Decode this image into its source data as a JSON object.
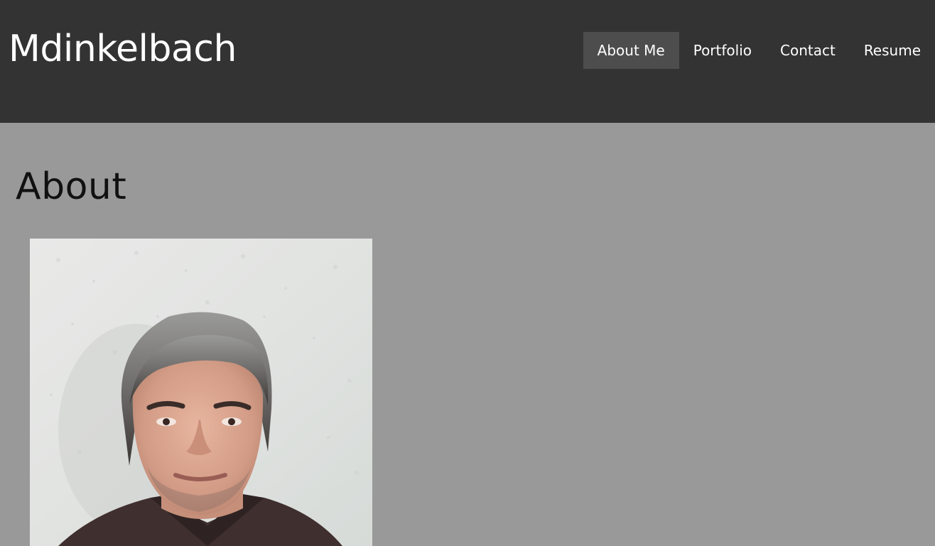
{
  "header": {
    "site_title": "Mdinkelbach",
    "nav": [
      {
        "label": "About Me",
        "active": true
      },
      {
        "label": "Portfolio",
        "active": false
      },
      {
        "label": "Contact",
        "active": false
      },
      {
        "label": "Resume",
        "active": false
      }
    ]
  },
  "main": {
    "heading": "About",
    "photo": {
      "subject": "portrait"
    }
  },
  "colors": {
    "header_bg": "#333333",
    "page_bg": "#999999",
    "active_nav_bg": "#4d4d4d",
    "text_light": "#ffffff",
    "text_dark": "#111111"
  }
}
